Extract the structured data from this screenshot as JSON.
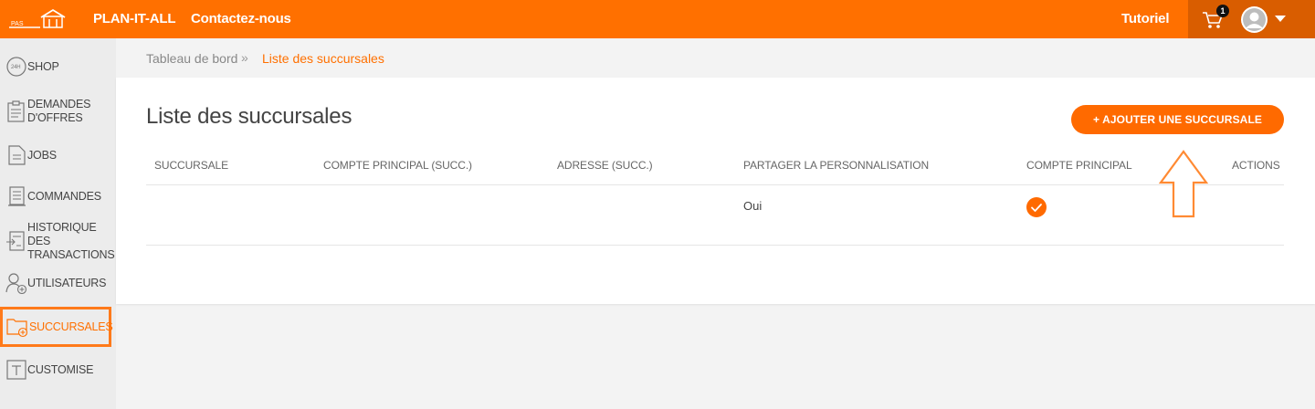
{
  "header": {
    "brand": "PLAN-IT-ALL",
    "contact": "Contactez-nous",
    "tutorial": "Tutoriel",
    "cart_count": "1",
    "colors": {
      "bar": "#ff7000",
      "user_area": "#d95d00"
    }
  },
  "sidebar": {
    "items": [
      {
        "label": "SHOP",
        "icon": "shop-24h-icon"
      },
      {
        "label": "DEMANDES D'OFFRES",
        "icon": "clipboard-icon"
      },
      {
        "label": "JOBS",
        "icon": "document-icon"
      },
      {
        "label": "COMMANDES",
        "icon": "list-document-icon"
      },
      {
        "label": "HISTORIQUE DES TRANSACTIONS",
        "icon": "transactions-icon"
      },
      {
        "label": "UTILISATEURS",
        "icon": "add-user-icon"
      },
      {
        "label": "SUCCURSALES",
        "icon": "folder-add-icon",
        "active": true
      },
      {
        "label": "CUSTOMISE",
        "icon": "customise-icon"
      }
    ]
  },
  "breadcrumb": {
    "home": "Tableau de bord",
    "separator": "»",
    "current": "Liste des succursales"
  },
  "main": {
    "title": "Liste des succursales",
    "add_button": "+ AJOUTER UNE SUCCURSALE",
    "columns": [
      "SUCCURSALE",
      "COMPTE PRINCIPAL (SUCC.)",
      "ADRESSE (SUCC.)",
      "PARTAGER LA PERSONNALISATION",
      "COMPTE PRINCIPAL",
      "ACTIONS"
    ],
    "rows": [
      {
        "succursale": "",
        "compte_principal_succ": "",
        "adresse_succ": "",
        "partager": "Oui",
        "compte_principal": true,
        "actions": ""
      }
    ]
  },
  "accent_color": "#ff6a00"
}
